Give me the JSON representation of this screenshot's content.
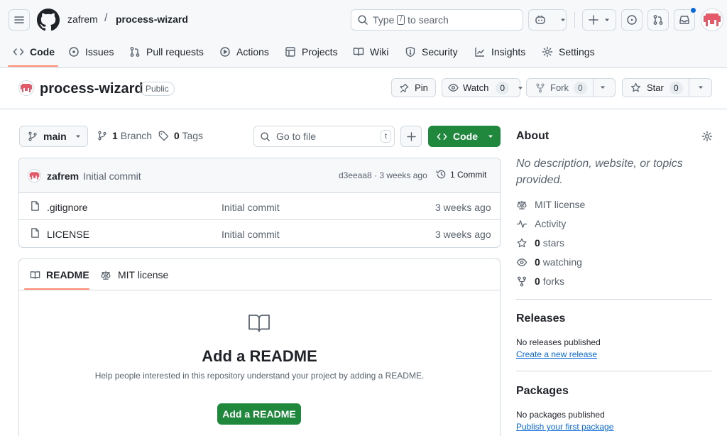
{
  "header": {
    "owner": "zafrem",
    "separator": "/",
    "repo": "process-wizard",
    "search_prefix": "Type",
    "search_key": "/",
    "search_suffix": "to search"
  },
  "tabs": [
    {
      "label": "Code"
    },
    {
      "label": "Issues"
    },
    {
      "label": "Pull requests"
    },
    {
      "label": "Actions"
    },
    {
      "label": "Projects"
    },
    {
      "label": "Wiki"
    },
    {
      "label": "Security"
    },
    {
      "label": "Insights"
    },
    {
      "label": "Settings"
    }
  ],
  "repo_header": {
    "name": "process-wizard",
    "visibility": "Public",
    "pin": "Pin",
    "watch": "Watch",
    "watch_count": "0",
    "fork": "Fork",
    "fork_count": "0",
    "star": "Star",
    "star_count": "0"
  },
  "toolbar": {
    "branch": "main",
    "branch_count": "1",
    "branch_label": "Branch",
    "tag_count": "0",
    "tag_label": "Tags",
    "goto_placeholder": "Go to file",
    "goto_key": "t",
    "code_label": "Code"
  },
  "commit": {
    "author": "zafrem",
    "message": "Initial commit",
    "meta": "d3eeaa8 · 3 weeks ago",
    "count_label": "1 Commit"
  },
  "files": [
    {
      "name": ".gitignore",
      "message": "Initial commit",
      "time": "3 weeks ago"
    },
    {
      "name": "LICENSE",
      "message": "Initial commit",
      "time": "3 weeks ago"
    }
  ],
  "readme": {
    "tab_readme": "README",
    "tab_license": "MIT license",
    "title": "Add a README",
    "description": "Help people interested in this repository understand your project by adding a README.",
    "button": "Add a README"
  },
  "about": {
    "title": "About",
    "description": "No description, website, or topics provided.",
    "license": "MIT license",
    "activity": "Activity",
    "stars_count": "0",
    "stars_label": "stars",
    "watching_count": "0",
    "watching_label": "watching",
    "forks_count": "0",
    "forks_label": "forks"
  },
  "releases": {
    "title": "Releases",
    "empty": "No releases published",
    "link": "Create a new release"
  },
  "packages": {
    "title": "Packages",
    "empty": "No packages published",
    "link": "Publish your first package"
  },
  "colors": {
    "accent_green": "#1f883d",
    "link_blue": "#0969da",
    "tab_underline": "#fd8c73",
    "notification_dot": "#0969da"
  }
}
